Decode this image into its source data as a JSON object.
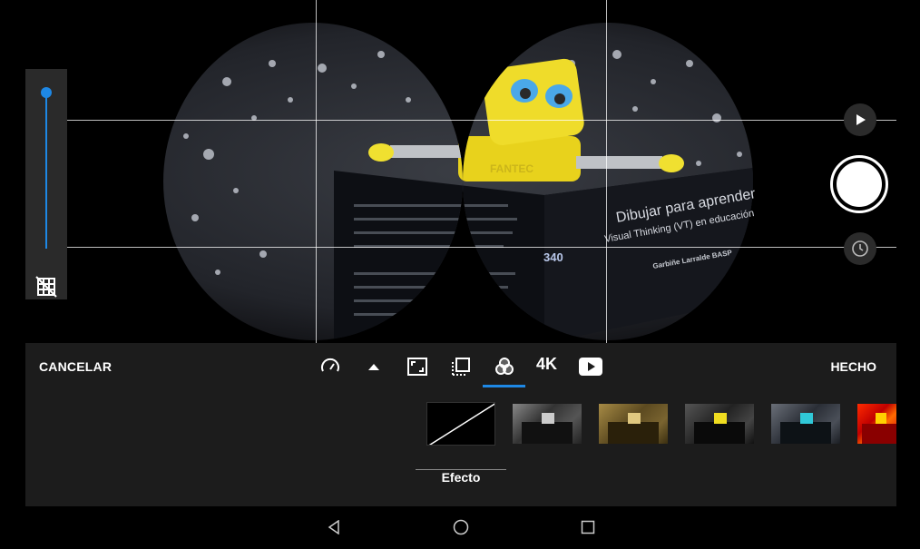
{
  "viewfinder": {
    "book_title_line1": "Dibujar para aprender",
    "book_title_line2": "Visual Thinking (VT) en educación",
    "book_author": "Garbiñe Larralde BASP",
    "page_number": "340",
    "robot_label": "FANTEC"
  },
  "side_controls": {
    "preview_icon": "play-icon",
    "shutter_icon": "shutter-icon",
    "timer_icon": "timer-icon",
    "grid_icon": "grid-off-icon"
  },
  "edit_bar": {
    "cancel_label": "CANCELAR",
    "done_label": "HECHO",
    "resolution_label": "4K",
    "active_tool": "effects-icon",
    "tools": [
      "speed-icon",
      "expand-arrow-icon",
      "aspect-ratio-icon",
      "timelapse-icon",
      "effects-icon",
      "youtube-icon"
    ]
  },
  "filters": {
    "selected_label": "Efecto",
    "items": [
      "none",
      "grayscale",
      "sepia",
      "vivid",
      "cyan",
      "heat"
    ]
  },
  "colors": {
    "accent": "#1e88e5",
    "panel": "#1c1c1c"
  }
}
